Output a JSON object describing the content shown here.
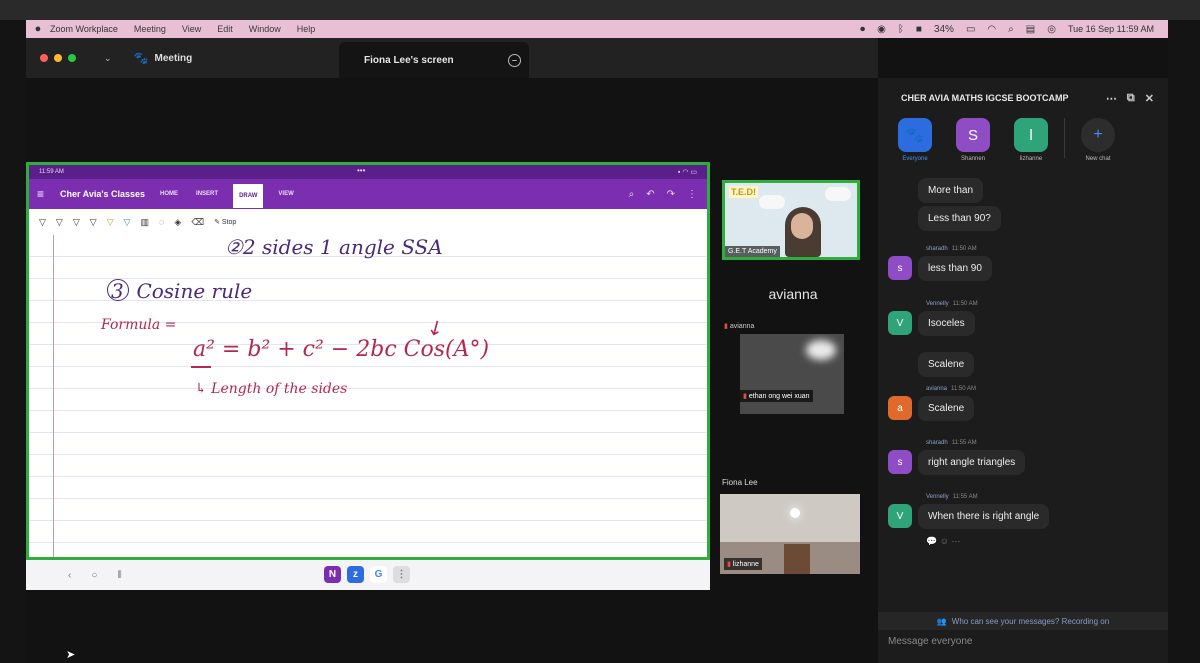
{
  "menubar": {
    "app": "Zoom Workplace",
    "items": [
      "Meeting",
      "View",
      "Edit",
      "Window",
      "Help"
    ],
    "battery": "34%",
    "clock": "Tue 16 Sep  11:59 AM"
  },
  "titlebar": {
    "meeting_label": "Meeting",
    "screen_tab": "Fiona Lee's screen"
  },
  "shared_screen": {
    "tablet_time": "11:59 AM",
    "notebook": "Cher Avia's Classes",
    "tabs": [
      "HOME",
      "INSERT",
      "DRAW",
      "VIEW"
    ],
    "active_tab": "DRAW",
    "stop_label": "Stop",
    "note_line1": "②2 sides 1 angle  SSA",
    "note_line2": "Cosine rule",
    "circle_num": "3",
    "formula_label": "Formula =",
    "formula": "a² = b² + c² − 2bc Cos(A°)",
    "side_note": "↳ Length of the sides"
  },
  "gallery": {
    "tile1_logo": "T.E.D!",
    "tile1_name": "G.E.T Academy",
    "avianna_label": "avianna",
    "avianna_name": "avianna",
    "ethan_name": "ethan ong wei xuan",
    "fiona_label": "Fiona Lee",
    "lizhanne_name": "lizhanne"
  },
  "chat": {
    "title": "CHER AVIA MATHS IGCSE BOOTCAMP",
    "recipients": [
      {
        "label": "Everyone",
        "initial": "",
        "color": "#2d6cdf"
      },
      {
        "label": "Shannen",
        "initial": "S",
        "color": "#8e4dc4"
      },
      {
        "label": "lizhanne",
        "initial": "l",
        "color": "#2fa37a"
      }
    ],
    "new_chat_label": "New chat",
    "messages": [
      {
        "sender": "",
        "time": "",
        "text": "More than",
        "avatar": "",
        "color": ""
      },
      {
        "sender": "",
        "time": "",
        "text": "Less than 90?",
        "avatar": "",
        "color": ""
      },
      {
        "sender": "sharadh",
        "time": "11:50 AM",
        "text": "less than 90",
        "avatar": "s",
        "color": "#8e4dc4"
      },
      {
        "sender": "Vennelly",
        "time": "11:50 AM",
        "text": "Isoceles",
        "avatar": "V",
        "color": "#2fa37a"
      },
      {
        "sender": "",
        "time": "",
        "text": "Scalene",
        "avatar": "",
        "color": ""
      },
      {
        "sender": "avianna",
        "time": "11:50 AM",
        "text": "Scalene",
        "avatar": "a",
        "color": "#e06a2b"
      },
      {
        "sender": "sharadh",
        "time": "11:55 AM",
        "text": "right angle triangles",
        "avatar": "s",
        "color": "#8e4dc4"
      },
      {
        "sender": "Vennelly",
        "time": "11:55 AM",
        "text": "When there is right angle",
        "avatar": "V",
        "color": "#2fa37a"
      }
    ],
    "privacy_text": "Who can see your messages? Recording on",
    "compose_placeholder": "Message everyone"
  }
}
